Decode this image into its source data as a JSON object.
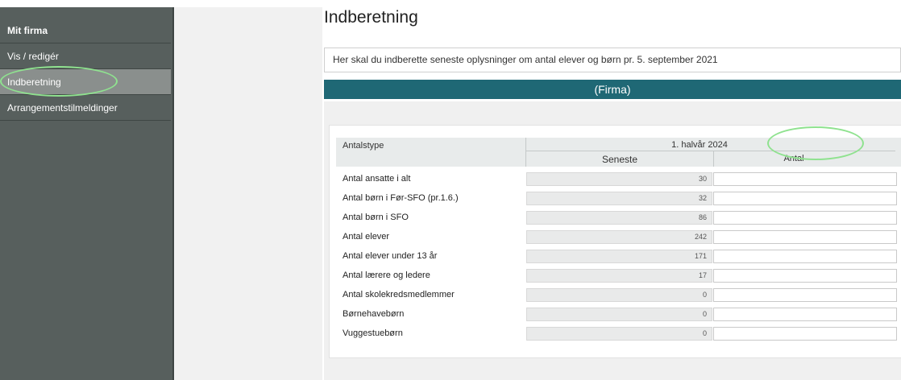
{
  "sidebar": {
    "header": "Mit firma",
    "items": [
      {
        "label": "Vis / redigér"
      },
      {
        "label": "Indberetning"
      },
      {
        "label": "Arrangementstilmeldinger"
      }
    ]
  },
  "page": {
    "title": "Indberetning",
    "notice": "Her skal du indberette seneste oplysninger om antal elever og børn pr. 5. september 2021",
    "firma": "(Firma)"
  },
  "table": {
    "col_type": "Antalstype",
    "period": "1. halvår 2024",
    "col_latest": "Seneste",
    "col_count": "Antal",
    "rows": [
      {
        "label": "Antal ansatte i alt",
        "latest": "30",
        "count": ""
      },
      {
        "label": "Antal børn i Før-SFO (pr.1.6.)",
        "latest": "32",
        "count": ""
      },
      {
        "label": "Antal børn i SFO",
        "latest": "86",
        "count": ""
      },
      {
        "label": "Antal elever",
        "latest": "242",
        "count": ""
      },
      {
        "label": "Antal elever under 13 år",
        "latest": "171",
        "count": ""
      },
      {
        "label": "Antal lærere og ledere",
        "latest": "17",
        "count": ""
      },
      {
        "label": "Antal skolekredsmedlemmer",
        "latest": "0",
        "count": ""
      },
      {
        "label": "Børnehavebørn",
        "latest": "0",
        "count": ""
      },
      {
        "label": "Vuggestuebørn",
        "latest": "0",
        "count": ""
      }
    ]
  },
  "annotations": {
    "highlight_color": "#8fe28f"
  }
}
